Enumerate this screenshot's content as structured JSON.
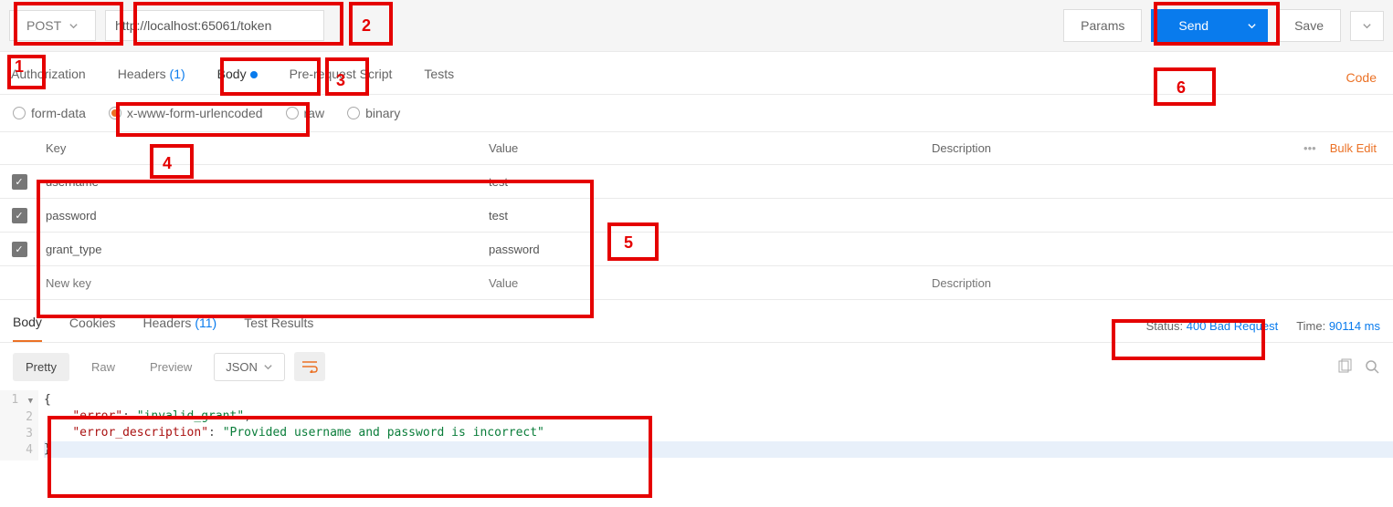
{
  "toolbar": {
    "method": "POST",
    "url": "http://localhost:65061/token",
    "params_label": "Params",
    "send_label": "Send",
    "save_label": "Save"
  },
  "tabs": {
    "authorization": "Authorization",
    "headers": "Headers",
    "headers_count": "(1)",
    "body": "Body",
    "prerequest": "Pre-request Script",
    "tests": "Tests",
    "code_link": "Code"
  },
  "body_types": {
    "formdata": "form-data",
    "urlencoded": "x-www-form-urlencoded",
    "raw": "raw",
    "binary": "binary"
  },
  "table": {
    "header_key": "Key",
    "header_value": "Value",
    "header_desc": "Description",
    "bulk_edit": "Bulk Edit",
    "rows": [
      {
        "key": "username",
        "value": "test"
      },
      {
        "key": "password",
        "value": "test"
      },
      {
        "key": "grant_type",
        "value": "password"
      }
    ],
    "placeholder_key": "New key",
    "placeholder_value": "Value",
    "placeholder_desc": "Description"
  },
  "response": {
    "tabs": {
      "body": "Body",
      "cookies": "Cookies",
      "headers": "Headers",
      "headers_count": "(11)",
      "tests": "Test Results"
    },
    "status_label": "Status:",
    "status_value": "400 Bad Request",
    "time_label": "Time:",
    "time_value": "90114 ms",
    "views": {
      "pretty": "Pretty",
      "raw": "Raw",
      "preview": "Preview",
      "format": "JSON"
    },
    "json": {
      "error_key": "\"error\"",
      "error_val": "\"invalid_grant\"",
      "desc_key": "\"error_description\"",
      "desc_val": "\"Provided username and password is incorrect\""
    }
  },
  "annotations": {
    "1": "1",
    "2": "2",
    "3": "3",
    "4": "4",
    "5": "5",
    "6": "6"
  }
}
